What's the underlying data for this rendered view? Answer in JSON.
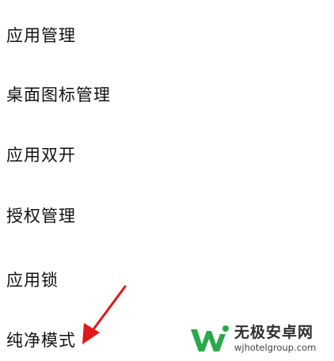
{
  "menu": {
    "items": [
      {
        "label": "应用管理"
      },
      {
        "label": "桌面图标管理"
      },
      {
        "label": "应用双开"
      },
      {
        "label": "授权管理"
      },
      {
        "label": "应用锁"
      },
      {
        "label": "纯净模式"
      }
    ]
  },
  "annotation": {
    "arrow_color": "#e01818",
    "icon": "red-arrow-icon"
  },
  "watermark": {
    "site_name": "无极安卓网",
    "url": "wjhotelgroup.com",
    "logo_color": "#2aa84a",
    "icon": "w-logo-icon"
  }
}
